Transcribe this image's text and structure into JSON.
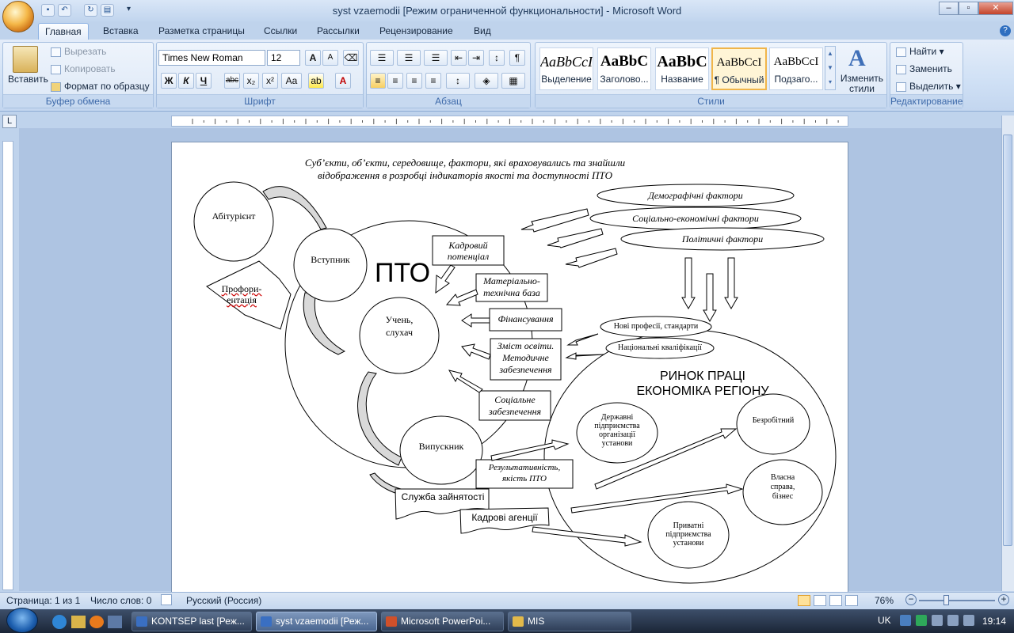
{
  "window": {
    "title": "syst vzaemodii [Режим ограниченной функциональности] - Microsoft Word"
  },
  "tabs": [
    "Главная",
    "Вставка",
    "Разметка страницы",
    "Ссылки",
    "Рассылки",
    "Рецензирование",
    "Вид"
  ],
  "clipboard": {
    "paste": "Вставить",
    "cut": "Вырезать",
    "copy": "Копировать",
    "format_painter": "Формат по образцу",
    "label": "Буфер обмена"
  },
  "font": {
    "name": "Times New Roman",
    "size": "12",
    "label": "Шрифт",
    "bold": "Ж",
    "italic": "К",
    "underline": "Ч",
    "strike": "abc",
    "sub": "x₂",
    "sup": "x²",
    "case": "Aa",
    "grow": "A",
    "shrink": "A"
  },
  "paragraph": {
    "label": "Абзац"
  },
  "styles": {
    "label": "Стили",
    "items": [
      {
        "sample": "AaBbCcI",
        "name": "Выделение"
      },
      {
        "sample": "AaBbC",
        "name": "Заголово..."
      },
      {
        "sample": "AaBbC",
        "name": "Название"
      },
      {
        "sample": "AaBbCcI",
        "name": "¶ Обычный"
      },
      {
        "sample": "AaBbCcI",
        "name": "Подзаго..."
      }
    ],
    "change": "Изменить стили"
  },
  "editing": {
    "find": "Найти",
    "replace": "Заменить",
    "select": "Выделить",
    "label": "Редактирование"
  },
  "diagram": {
    "title_line1": "Суб’єкти, об’єкти, середовище, фактори, які враховувались та знайшли",
    "title_line2": "відображення в розробці індикаторів якості та доступності ПТО",
    "abiturient": "Абітурієнт",
    "vstupnyk": "Вступник",
    "proforientation": "Профори-ентація",
    "pto": "ПТО",
    "student_1": "Учень,",
    "student_2": "слухач",
    "vypusknyk": "Випускник",
    "kadrovyi_1": "Кадровий",
    "kadrovyi_2": "потенціал",
    "mtb_1": "Матеріально-",
    "mtb_2": "технічна база",
    "finance": "Фінансування",
    "content_1": "Зміст освіти.",
    "content_2": "Методичне",
    "content_3": "забезпечення",
    "social_1": "Соціальне",
    "social_2": "забезпечення",
    "result_1": "Результативність,",
    "result_2": "якість  ПТО",
    "employment": "Служба зайнятості",
    "agencies": "Кадрові агенції",
    "demographic": "Демографічні фактори",
    "socio": "Соціально-економічні фактори",
    "political": "Політичні  фактори",
    "new_prof": "Нові професії, стандарти",
    "nat_qual": "Національні   кваліфікації",
    "market_1": "РИНОК ПРАЦІ",
    "market_2": "ЕКОНОМІКА РЕГІОНУ",
    "state_1": "Державні",
    "state_2": "підприємства",
    "state_3": "організації",
    "state_4": "установи",
    "unemployed": "Безробітний",
    "own_1": "Власна",
    "own_2": "справа,",
    "own_3": "бізнес",
    "private_1": "Приватні",
    "private_2": "підприємства",
    "private_3": "установи"
  },
  "status": {
    "page": "Страница: 1 из 1",
    "words": "Число слов: 0",
    "lang": "Русский (Россия)",
    "zoom": "76%"
  },
  "taskbar": {
    "items": [
      "KONTSEP  last [Реж...",
      "syst vzaemodii [Реж...",
      "Microsoft PowerPoi...",
      "MIS"
    ],
    "lang": "UK",
    "clock": "19:14"
  }
}
